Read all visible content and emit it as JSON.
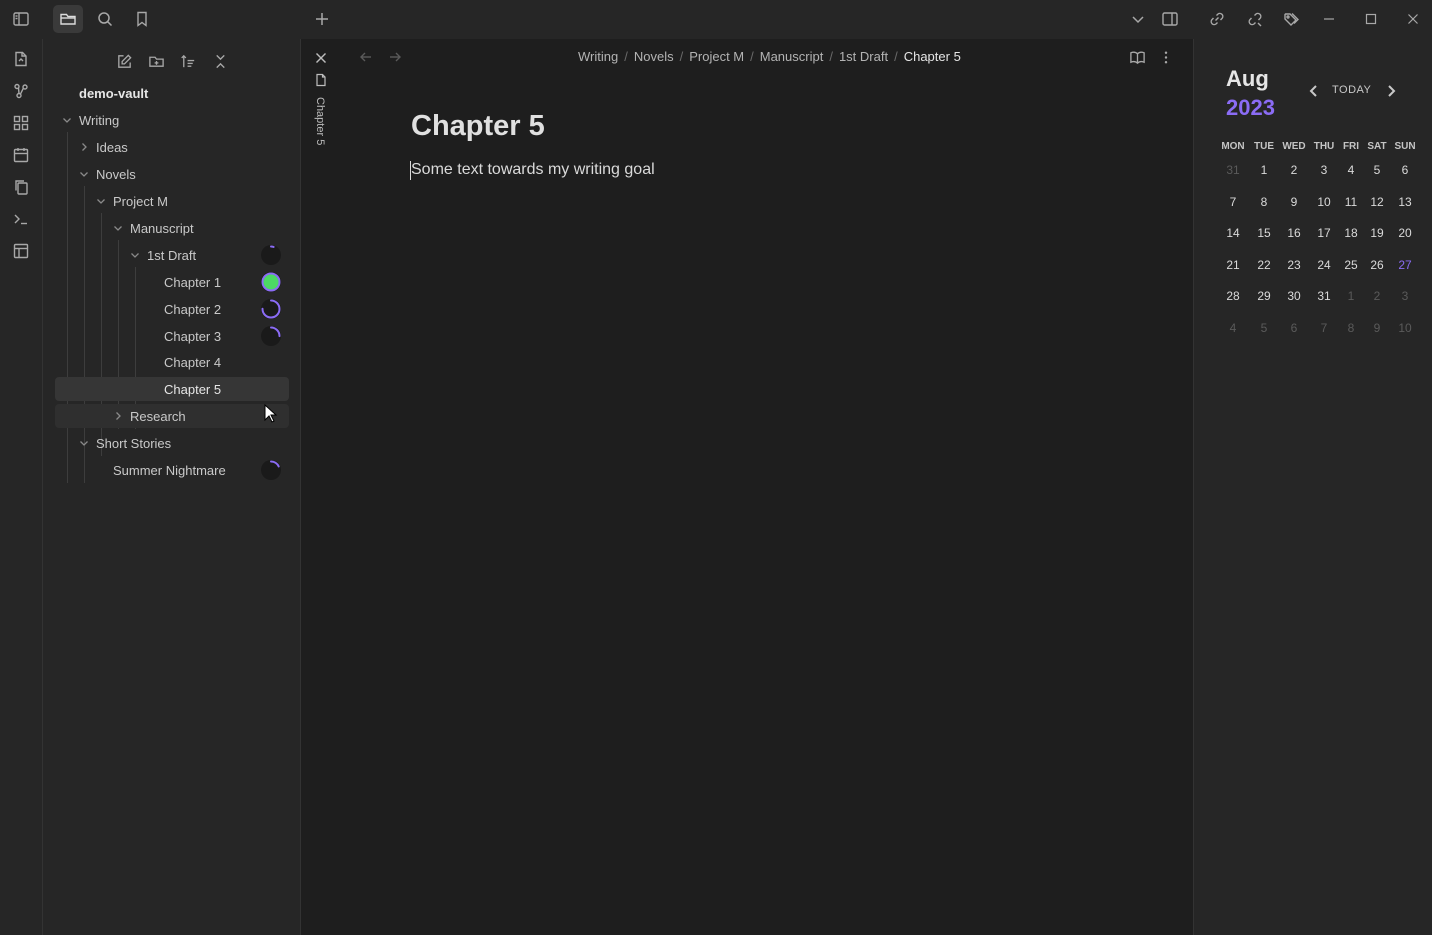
{
  "window": {
    "controls": [
      "minimize-icon",
      "maximize-icon",
      "close-icon"
    ]
  },
  "titlebar": {
    "left_icons": [
      "sidebar-toggle-icon",
      "folder-icon",
      "search-icon",
      "bookmark-icon"
    ],
    "new_tab_icon": "plus-icon",
    "right_icons": [
      "chevron-down-icon",
      "right-sidebar-toggle-icon",
      "link-icon",
      "unlink-icon",
      "tags-icon"
    ]
  },
  "ribbon": {
    "icons": [
      "file-icon",
      "graph-icon",
      "grid-icon",
      "calendar-icon",
      "copy-icon",
      "terminal-icon",
      "layout-icon"
    ]
  },
  "explorer": {
    "toolbar": [
      "new-note-icon",
      "new-folder-icon",
      "sort-icon",
      "collapse-all-icon"
    ],
    "vault_name": "demo-vault",
    "tree": [
      {
        "label": "Writing"
      },
      {
        "label": "Ideas"
      },
      {
        "label": "Novels"
      },
      {
        "label": "Project M"
      },
      {
        "label": "Manuscript"
      },
      {
        "label": "1st Draft",
        "progress": 0.05
      },
      {
        "label": "Chapter 1",
        "progress": 1.0
      },
      {
        "label": "Chapter 2",
        "progress": 0.75
      },
      {
        "label": "Chapter 3",
        "progress": 0.25
      },
      {
        "label": "Chapter 4"
      },
      {
        "label": "Chapter 5"
      },
      {
        "label": "Research"
      },
      {
        "label": "Short Stories"
      },
      {
        "label": "Summer Nightmare",
        "progress": 0.18
      }
    ]
  },
  "tab": {
    "label": "Chapter 5"
  },
  "editor": {
    "breadcrumb": [
      "Writing",
      "Novels",
      "Project M",
      "Manuscript",
      "1st Draft",
      "Chapter 5"
    ],
    "title": "Chapter 5",
    "body": "Some text towards my writing goal"
  },
  "calendar": {
    "month": "Aug",
    "year": "2023",
    "today_label": "TODAY",
    "weekdays": [
      "MON",
      "TUE",
      "WED",
      "THU",
      "FRI",
      "SAT",
      "SUN"
    ],
    "weeks": [
      [
        "31",
        "1",
        "2",
        "3",
        "4",
        "5",
        "6"
      ],
      [
        "7",
        "8",
        "9",
        "10",
        "11",
        "12",
        "13"
      ],
      [
        "14",
        "15",
        "16",
        "17",
        "18",
        "19",
        "20"
      ],
      [
        "21",
        "22",
        "23",
        "24",
        "25",
        "26",
        "27"
      ],
      [
        "28",
        "29",
        "30",
        "31",
        "1",
        "2",
        "3"
      ],
      [
        "4",
        "5",
        "6",
        "7",
        "8",
        "9",
        "10"
      ]
    ],
    "accent": "#8b6cf5",
    "progress_done_color": "#4cd964"
  }
}
